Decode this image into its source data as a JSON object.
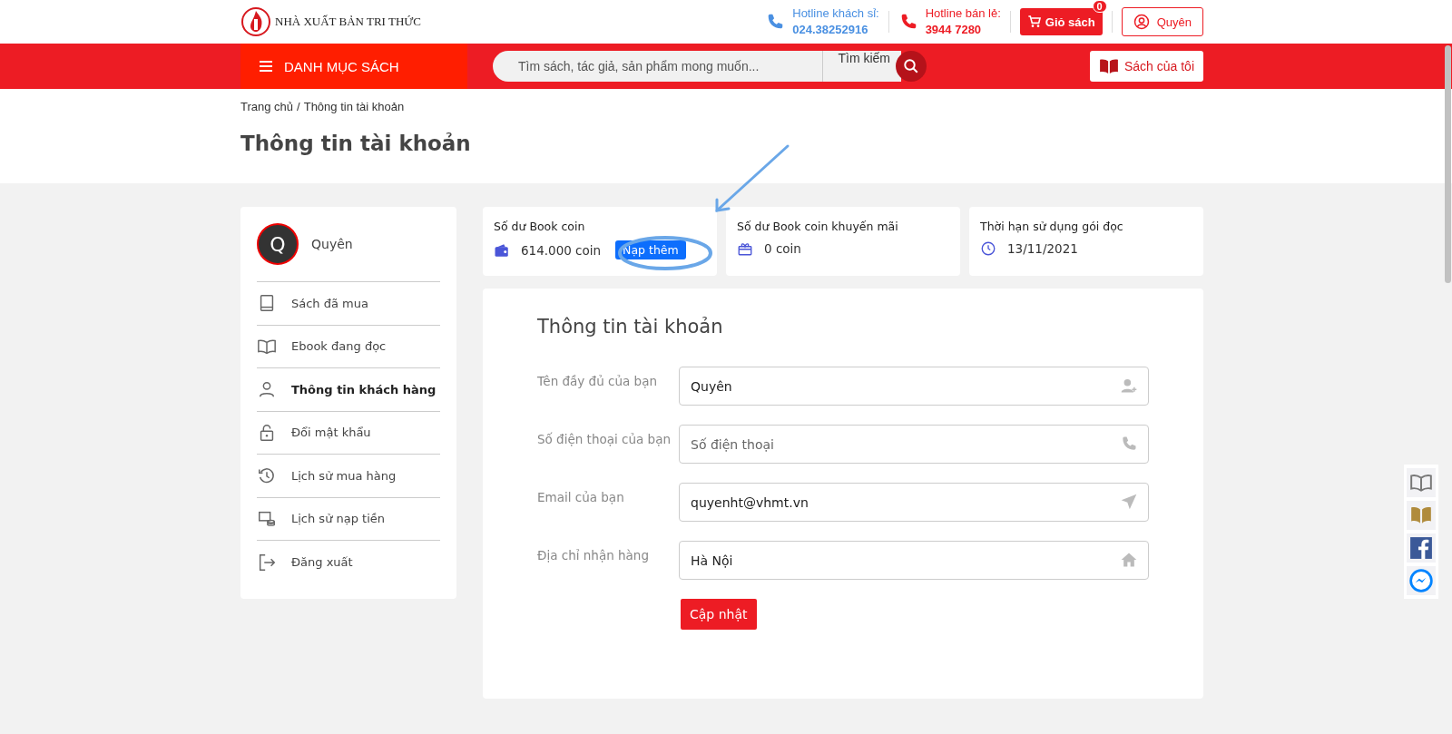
{
  "header": {
    "logo_text": "NHÀ XUẤT BẢN TRI THỨC",
    "hotlines": [
      {
        "label": "Hotline khách sỉ:",
        "number": "024.38252916",
        "color": "#4a90e2"
      },
      {
        "label": "Hotline bán lẻ:",
        "number": "3944 7280",
        "color": "#ed1c24"
      }
    ],
    "cart": {
      "label": "Giỏ sách",
      "count": "0"
    },
    "account": "Quyên"
  },
  "navbar": {
    "menu": "DANH MỤC SÁCH",
    "search": {
      "placeholder": "Tìm sách, tác giả, sản phẩm mong muốn...",
      "button": "Tìm kiếm"
    },
    "my_books": "Sách của tôi"
  },
  "breadcrumb": {
    "items": [
      "Trang chủ",
      "Thông tin tài khoản"
    ],
    "separator": "/"
  },
  "page_title": "Thông tin tài khoản",
  "sidebar": {
    "avatar_letter": "Q",
    "user": "Quyên",
    "items": [
      {
        "label": "Sách đã mua",
        "selected": false
      },
      {
        "label": "Ebook đang đọc",
        "selected": false
      },
      {
        "label": "Thông tin khách hàng",
        "selected": true
      },
      {
        "label": "Đổi mật khẩu",
        "selected": false
      },
      {
        "label": "Lịch sử mua hàng",
        "selected": false
      },
      {
        "label": "Lịch sử nạp tiền",
        "selected": false
      },
      {
        "label": "Đăng xuất",
        "selected": false
      }
    ]
  },
  "stats": [
    {
      "title": "Số dư Book coin",
      "value": "614.000 coin",
      "button": "Nạp thêm"
    },
    {
      "title": "Số dư Book coin khuyến mãi",
      "value": "0 coin"
    },
    {
      "title": "Thời hạn sử dụng gói đọc",
      "value": "13/11/2021"
    }
  ],
  "form": {
    "title": "Thông tin tài khoản",
    "fields": [
      {
        "label": "Tên đầy đủ của bạn",
        "value": "Quyên"
      },
      {
        "label": "Số điện thoại của bạn",
        "placeholder": "Số điện thoại"
      },
      {
        "label": "Email của bạn",
        "value": "quyenht@vhmt.vn"
      },
      {
        "label": "Địa chỉ nhận hàng",
        "value": "Hà Nội"
      }
    ],
    "submit": "Cập nhật"
  }
}
